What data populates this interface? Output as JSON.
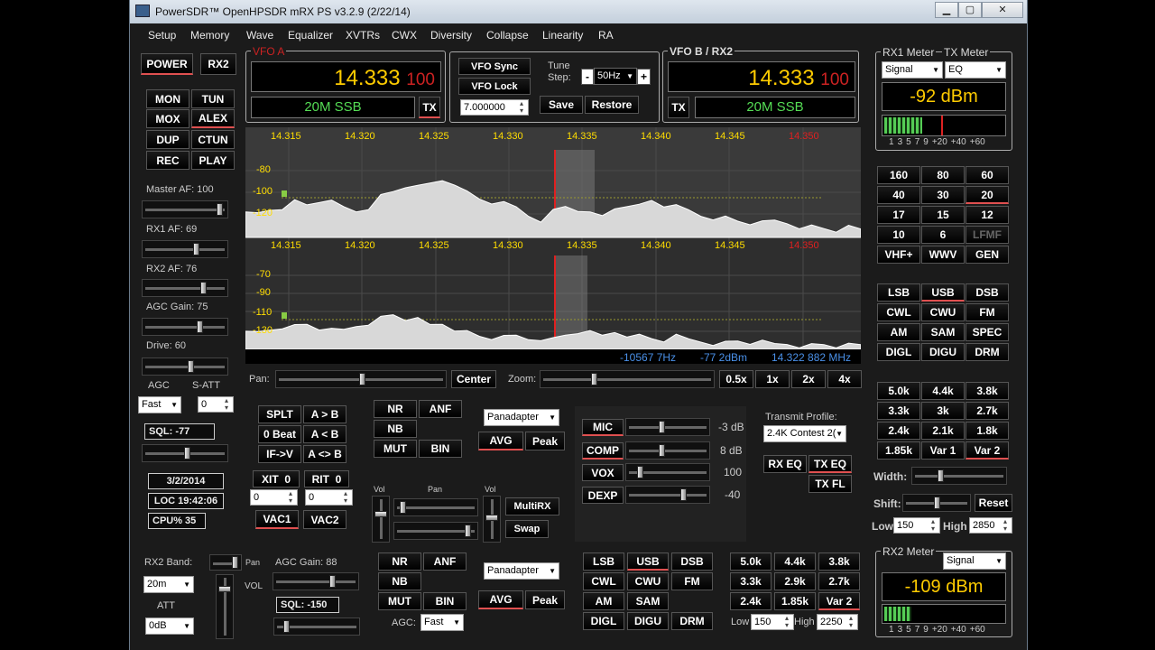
{
  "title": "PowerSDR™ OpenHPSDR mRX PS v3.2.9 (2/22/14)",
  "menu": [
    "Setup",
    "Memory",
    "Wave",
    "Equalizer",
    "XVTRs",
    "CWX",
    "Diversity",
    "Collapse",
    "Linearity",
    "RA"
  ],
  "left": {
    "power": "POWER",
    "rx2": "RX2",
    "mon": "MON",
    "tun": "TUN",
    "mox": "MOX",
    "alex": "ALEX",
    "dup": "DUP",
    "ctun": "CTUN",
    "rec": "REC",
    "play": "PLAY",
    "master_af": "Master AF:  100",
    "rx1_af": "RX1 AF:  69",
    "rx2_af": "RX2 AF:  76",
    "agc_gain": "AGC Gain:  75",
    "drive": "Drive:  60",
    "agc": "AGC",
    "satt": "S-ATT",
    "agc_mode": "Fast",
    "satt_val": "0",
    "sql": "SQL: -77",
    "date": "3/2/2014",
    "loc": "LOC 19:42:06",
    "cpu": "CPU%  35"
  },
  "vfoa": {
    "label": "VFO A",
    "freq": "14.333",
    "sub": "100",
    "mode": "20M SSB",
    "tx": "TX"
  },
  "vfob": {
    "label": "VFO B / RX2",
    "freq": "14.333",
    "sub": "100",
    "mode": "20M SSB",
    "tx": "TX"
  },
  "mid": {
    "sync": "VFO Sync",
    "lock": "VFO Lock",
    "tune": "Tune",
    "step": "Step:",
    "step_val": "50Hz",
    "minus": "-",
    "plus": "+",
    "freq_in": "7.000000",
    "save": "Save",
    "restore": "Restore"
  },
  "rx1meter": {
    "label": "RX1 Meter",
    "tx_label": "TX Meter",
    "sel": "Signal",
    "tx_sel": "EQ",
    "value": "-92 dBm",
    "scale": [
      "1",
      "3",
      "5",
      "7",
      "9",
      "+20",
      "+40",
      "+60"
    ]
  },
  "rx2meter": {
    "label": "RX2 Meter",
    "sel": "Signal",
    "value": "-109 dBm",
    "scale": [
      "1",
      "3",
      "5",
      "7",
      "9",
      "+20",
      "+40",
      "+60"
    ]
  },
  "pan1": {
    "ticks": [
      "14.315",
      "14.320",
      "14.325",
      "14.330",
      "14.335",
      "14.340",
      "14.345",
      "14.350"
    ],
    "db": [
      "-80",
      "-100",
      "-120"
    ]
  },
  "pan2": {
    "ticks": [
      "14.315",
      "14.320",
      "14.325",
      "14.330",
      "14.335",
      "14.340",
      "14.345",
      "14.350"
    ],
    "db": [
      "-70",
      "-90",
      "-110",
      "-130"
    ]
  },
  "status": {
    "offset": "-10567 7Hz",
    "dbm": "-77 2dBm",
    "mhz": "14.322 882 MHz"
  },
  "panrow": {
    "pan": "Pan:",
    "center": "Center",
    "zoom": "Zoom:",
    "z05": "0.5x",
    "z1": "1x",
    "z2": "2x",
    "z4": "4x"
  },
  "bands": [
    "160",
    "80",
    "60",
    "40",
    "30",
    "20",
    "17",
    "15",
    "12",
    "10",
    "6",
    "LFMF",
    "VHF+",
    "WWV",
    "GEN"
  ],
  "modes": [
    "LSB",
    "USB",
    "DSB",
    "CWL",
    "CWU",
    "FM",
    "AM",
    "SAM",
    "SPEC",
    "DIGL",
    "DIGU",
    "DRM"
  ],
  "filters": [
    "5.0k",
    "4.4k",
    "3.8k",
    "3.3k",
    "3k",
    "2.7k",
    "2.4k",
    "2.1k",
    "1.8k",
    "1.85k",
    "Var 1",
    "Var 2"
  ],
  "width": "Width:",
  "shift": "Shift:",
  "reset": "Reset",
  "low": "Low",
  "low_val": "150",
  "high": "High",
  "high_val": "2850",
  "split": {
    "splt": "SPLT",
    "atob": "A > B",
    "beat": "0 Beat",
    "btoa": "A < B",
    "ifv": "IF->V",
    "swap": "A <> B",
    "xit": "XIT",
    "xit_v": "0",
    "rit": "RIT",
    "rit_v": "0",
    "xit_in": "0",
    "rit_in": "0",
    "vac1": "VAC1",
    "vac2": "VAC2"
  },
  "dsp1": {
    "nr": "NR",
    "anf": "ANF",
    "nb": "NB",
    "mut": "MUT",
    "bin": "BIN",
    "display": "Panadapter",
    "avg": "AVG",
    "peak": "Peak"
  },
  "tx": {
    "mic": "MIC",
    "mic_v": "-3 dB",
    "comp": "COMP",
    "comp_v": "8 dB",
    "vox": "VOX",
    "vox_v": "100",
    "dexp": "DEXP",
    "dexp_v": "-40",
    "profile_label": "Transmit Profile:",
    "profile": "2.4K Contest 2(",
    "rxeq": "RX EQ",
    "txeq": "TX EQ",
    "txfl": "TX FL"
  },
  "mrx": {
    "vol": "Vol",
    "pan": "Pan",
    "vol2": "Vol",
    "multirx": "MultiRX",
    "swap": "Swap"
  },
  "rx2": {
    "band_label": "RX2 Band:",
    "band": "20m",
    "att": "ATT",
    "att_val": "0dB",
    "pan": "Pan",
    "vol": "VOL",
    "agc_gain": "AGC Gain:  88",
    "sql": "SQL: -150",
    "nr": "NR",
    "anf": "ANF",
    "nb": "NB",
    "mut": "MUT",
    "bin": "BIN",
    "agc": "AGC:",
    "agc_mode": "Fast",
    "display": "Panadapter",
    "avg": "AVG",
    "peak": "Peak",
    "modes": [
      "LSB",
      "USB",
      "DSB",
      "CWL",
      "CWU",
      "FM",
      "AM",
      "SAM",
      "",
      "DIGL",
      "DIGU",
      "DRM"
    ],
    "filters": [
      "5.0k",
      "4.4k",
      "3.8k",
      "3.3k",
      "2.9k",
      "2.7k",
      "2.4k",
      "1.85k",
      "Var 2"
    ],
    "low": "Low",
    "low_val": "150",
    "high": "High",
    "high_val": "2250"
  },
  "spectrum1": [
    0.3,
    0.32,
    0.38,
    0.42,
    0.48,
    0.44,
    0.5,
    0.46,
    0.4,
    0.36,
    0.42,
    0.55,
    0.62,
    0.7,
    0.66,
    0.72,
    0.78,
    0.75,
    0.6,
    0.52,
    0.48,
    0.44,
    0.4,
    0.3,
    0.25,
    0.35,
    0.42,
    0.38,
    0.3,
    0.28,
    0.4,
    0.46,
    0.42,
    0.5,
    0.44,
    0.4,
    0.36,
    0.3,
    0.28,
    0.26,
    0.22,
    0.2,
    0.18,
    0.22,
    0.2,
    0.16,
    0.14,
    0.12,
    0.1,
    0.12,
    0.1
  ],
  "spectrum2": [
    0.25,
    0.28,
    0.34,
    0.4,
    0.38,
    0.42,
    0.36,
    0.3,
    0.32,
    0.4,
    0.46,
    0.52,
    0.58,
    0.52,
    0.48,
    0.4,
    0.44,
    0.36,
    0.28,
    0.22,
    0.2,
    0.18,
    0.22,
    0.18,
    0.2,
    0.16,
    0.24,
    0.3,
    0.26,
    0.22,
    0.3,
    0.26,
    0.22,
    0.18,
    0.16,
    0.2,
    0.16,
    0.14,
    0.12,
    0.1,
    0.14,
    0.12,
    0.1,
    0.08,
    0.1,
    0.08,
    0.06,
    0.08,
    0.06,
    0.05,
    0.06
  ]
}
